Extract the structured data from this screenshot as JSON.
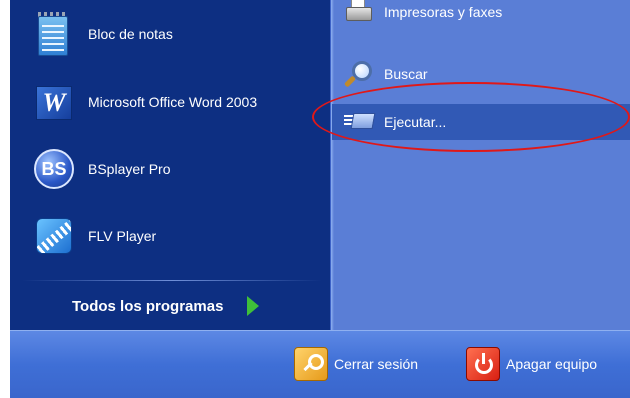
{
  "left_programs": [
    {
      "label": "Bloc de notas",
      "icon": "notepad-icon"
    },
    {
      "label": "Microsoft Office Word 2003",
      "icon": "word-icon"
    },
    {
      "label": "BSplayer Pro",
      "icon": "bsplayer-icon"
    },
    {
      "label": "FLV Player",
      "icon": "flv-player-icon"
    }
  ],
  "all_programs": {
    "label": "Todos los programas",
    "icon": "arrow-right-icon"
  },
  "right_items": [
    {
      "label": "Impresoras y faxes",
      "icon": "printer-icon"
    },
    {
      "label": "Buscar",
      "icon": "search-icon"
    },
    {
      "label": "Ejecutar...",
      "icon": "run-icon",
      "highlighted": true
    }
  ],
  "bottom_bar": {
    "logoff": {
      "label": "Cerrar sesión",
      "icon": "logoff-icon"
    },
    "shutdown": {
      "label": "Apagar equipo",
      "icon": "power-icon"
    }
  },
  "icon_labels": {
    "bsplayer": "BS",
    "word": "W"
  },
  "colors": {
    "left_pane": "#0d2f82",
    "right_pane": "#5a7ed6",
    "highlight": "#3159b5",
    "annotation": "#e01818",
    "bottom_bar": "#3f6fd6"
  }
}
